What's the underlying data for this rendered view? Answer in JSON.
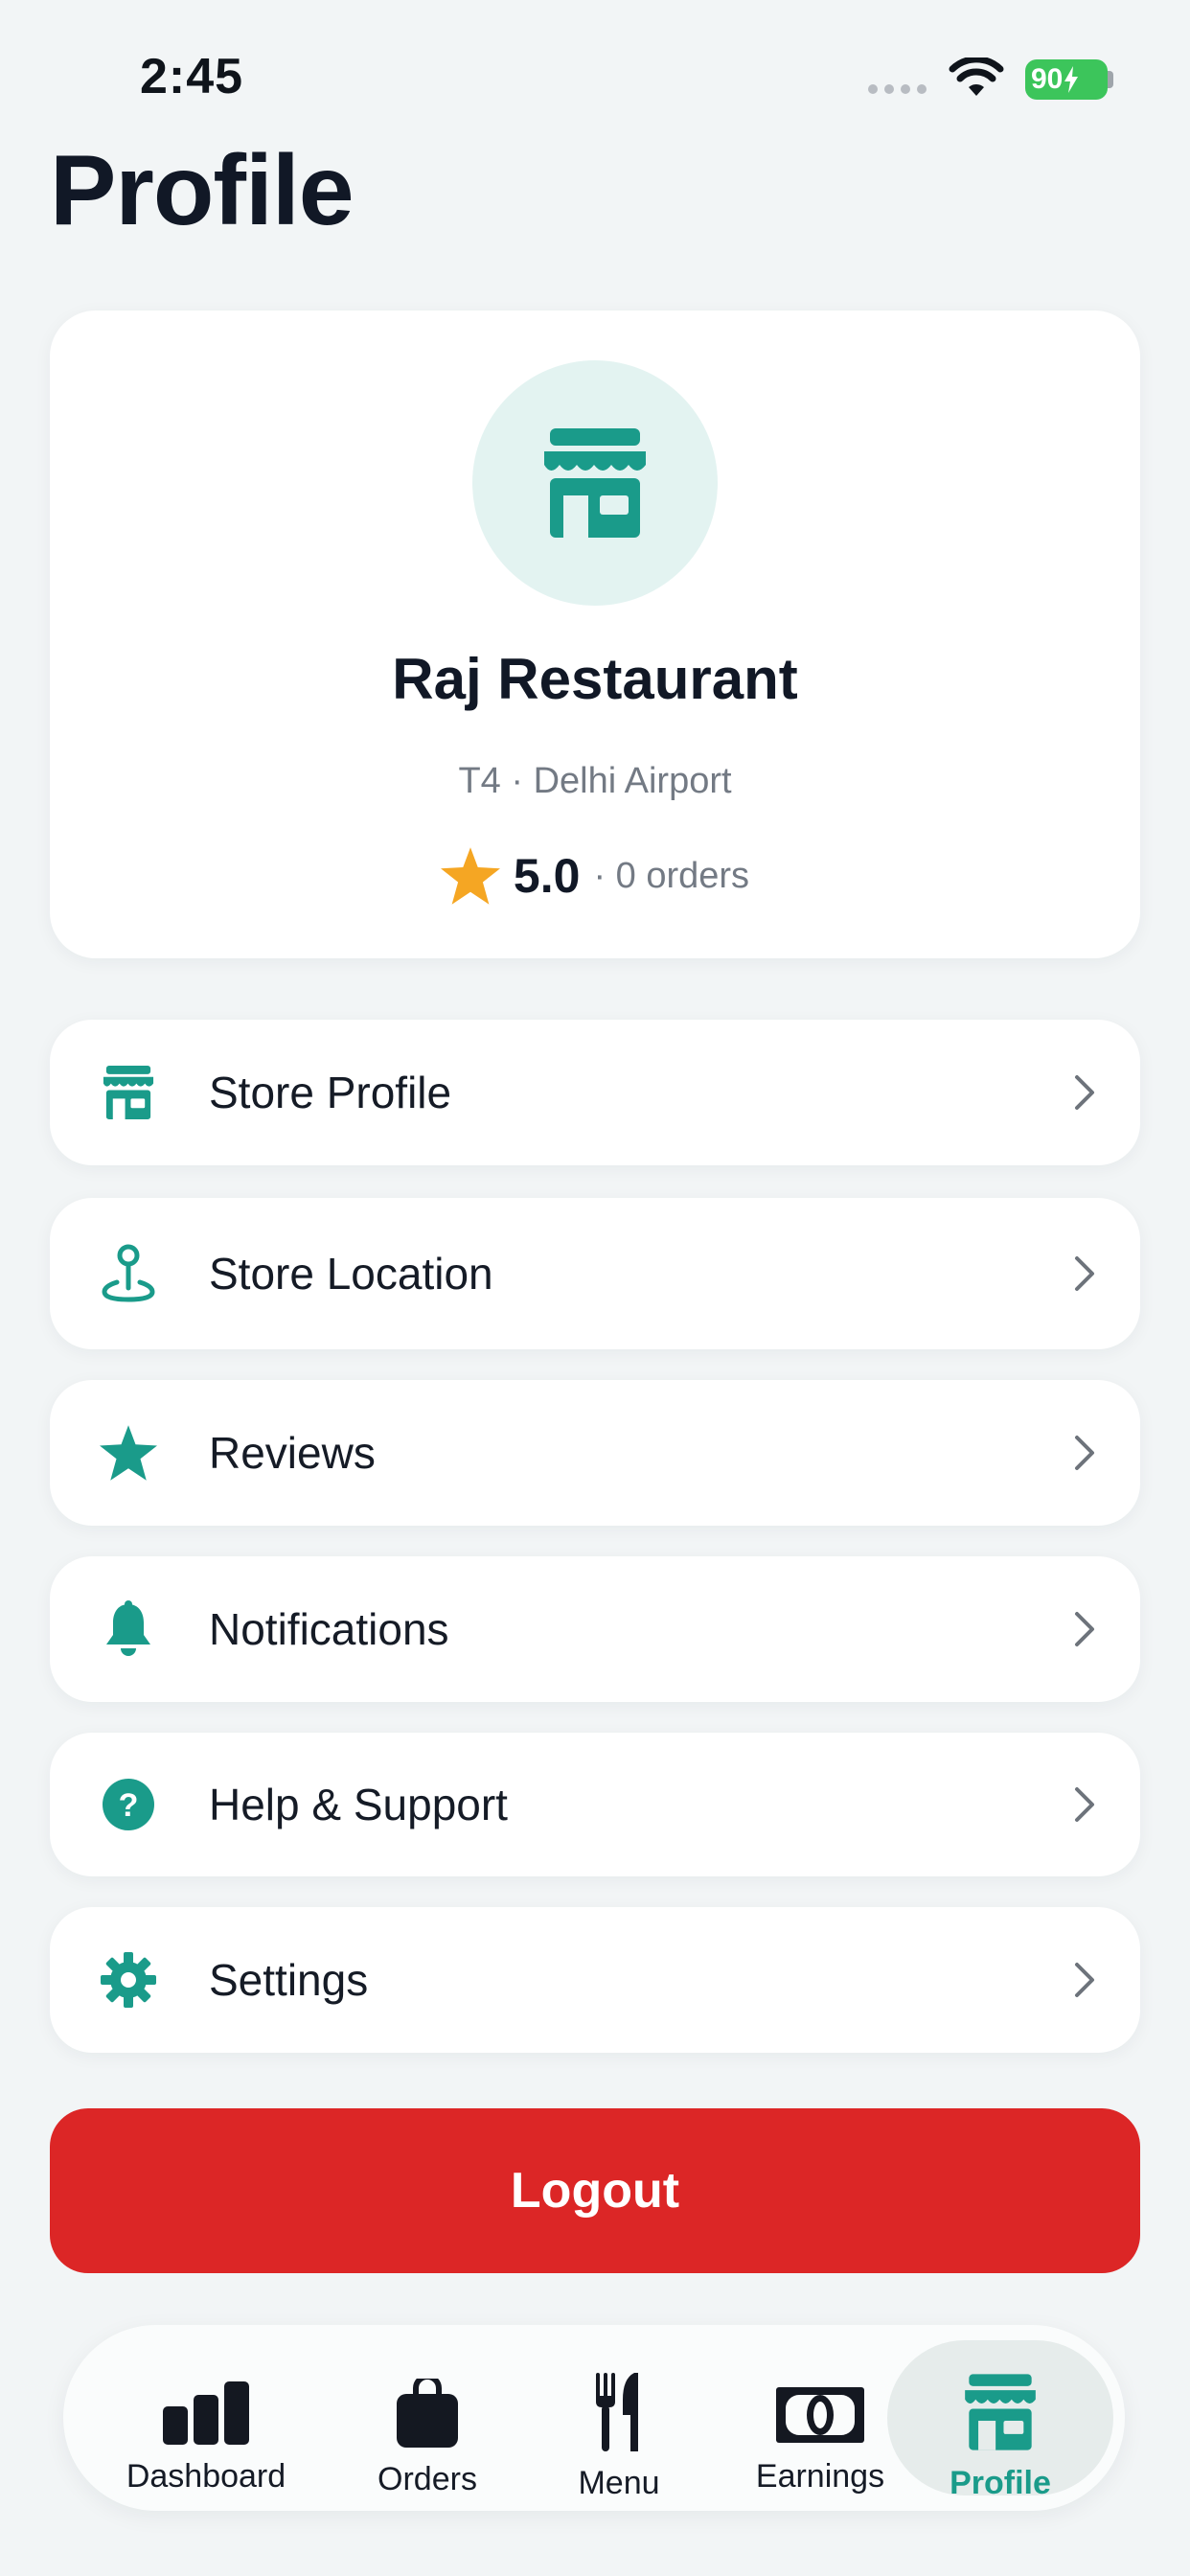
{
  "status_bar": {
    "time": "2:45",
    "battery": "90"
  },
  "header": {
    "title": "Profile"
  },
  "profile": {
    "name": "Raj Restaurant",
    "location": "T4 · Delhi Airport",
    "rating": "5.0",
    "orders": "· 0 orders"
  },
  "menu": [
    {
      "label": "Store Profile",
      "icon": "store-icon"
    },
    {
      "label": "Store Location",
      "icon": "location-pin-icon"
    },
    {
      "label": "Reviews",
      "icon": "star-icon"
    },
    {
      "label": "Notifications",
      "icon": "bell-icon"
    },
    {
      "label": "Help & Support",
      "icon": "help-icon"
    },
    {
      "label": "Settings",
      "icon": "gear-icon"
    }
  ],
  "logout": {
    "label": "Logout"
  },
  "tabs": [
    {
      "label": "Dashboard",
      "icon": "bar-chart-icon"
    },
    {
      "label": "Orders",
      "icon": "bag-icon"
    },
    {
      "label": "Menu",
      "icon": "fork-knife-icon"
    },
    {
      "label": "Earnings",
      "icon": "cash-icon"
    },
    {
      "label": "Profile",
      "icon": "store-icon",
      "active": true
    }
  ],
  "colors": {
    "accent": "#1a9b8a",
    "logout": "#dc2626",
    "star": "#f5a623",
    "background": "#f2f5f6"
  }
}
